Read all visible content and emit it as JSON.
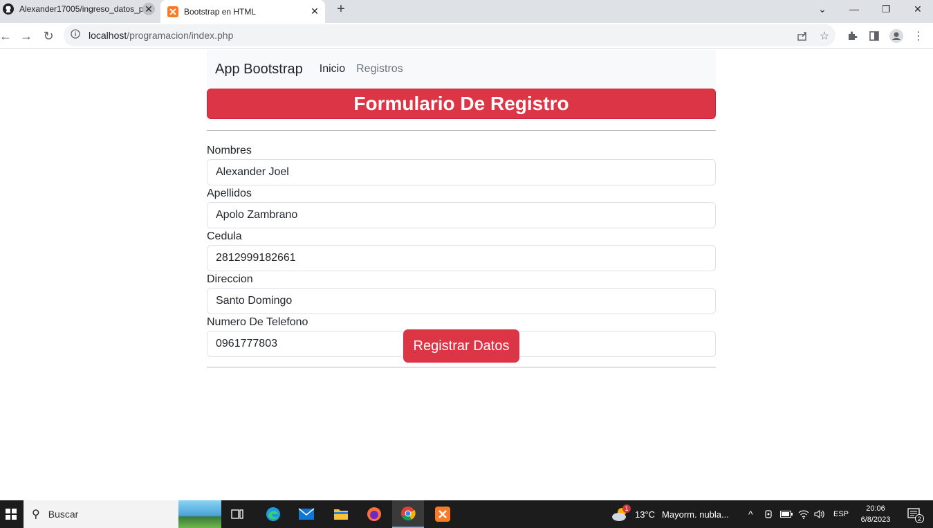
{
  "browser": {
    "tabs": [
      {
        "title": "Alexander17005/ingreso_datos_p",
        "icon": "github-icon",
        "active": false
      },
      {
        "title": "Bootstrap en HTML",
        "icon": "xampp-icon",
        "active": true
      }
    ],
    "url_host": "localhost",
    "url_path": "/programacion/index.php"
  },
  "navbar": {
    "brand": "App Bootstrap",
    "links": [
      {
        "label": "Inicio",
        "active": true
      },
      {
        "label": "Registros",
        "active": false
      }
    ]
  },
  "banner": {
    "title": "Formulario De Registro",
    "color": "#dc3545"
  },
  "form": {
    "fields": [
      {
        "label": "Nombres",
        "value": "Alexander Joel"
      },
      {
        "label": "Apellidos",
        "value": "Apolo Zambrano"
      },
      {
        "label": "Cedula",
        "value": "2812999182661"
      },
      {
        "label": "Direccion",
        "value": "Santo Domingo"
      },
      {
        "label": "Numero De Telefono",
        "value": "0961777803"
      }
    ],
    "submit_label": "Registrar Datos"
  },
  "taskbar": {
    "search_placeholder": "Buscar",
    "weather_temp": "13°C",
    "weather_desc": "Mayorm. nubla...",
    "weather_badge": "1",
    "language": "ESP",
    "time": "20:06",
    "date": "6/8/2023",
    "notification_count": "2"
  }
}
